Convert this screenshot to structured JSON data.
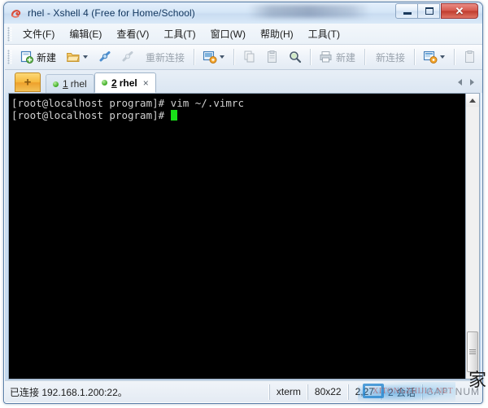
{
  "window": {
    "title": "rhel - Xshell 4 (Free for Home/School)",
    "app_icon": "xshell-icon",
    "minimize_label": "",
    "maximize_label": "",
    "close_label": "✕"
  },
  "menubar": {
    "items": [
      {
        "label": "文件(F)",
        "name": "menu-file"
      },
      {
        "label": "编辑(E)",
        "name": "menu-edit"
      },
      {
        "label": "查看(V)",
        "name": "menu-view"
      },
      {
        "label": "工具(T)",
        "name": "menu-tools"
      },
      {
        "label": "窗口(W)",
        "name": "menu-window"
      },
      {
        "label": "帮助(H)",
        "name": "menu-help"
      },
      {
        "label": "工具(T)",
        "name": "menu-tools-2"
      }
    ]
  },
  "toolbar": {
    "new_label": "新建",
    "open_label": "",
    "connect_label": "",
    "disconnect_label": "",
    "reconnect_label": "重新连接",
    "transfer_label": "",
    "copy_label": "",
    "paste_label": "",
    "find_label": "",
    "print_label": "新建",
    "newconn_label": "新连接",
    "sendkey_label": "",
    "clipboard_label": "",
    "highlight_label": "",
    "overflow_label": "»"
  },
  "tabs": {
    "new_tab_label": "+",
    "items": [
      {
        "number": "1",
        "title": "rhel",
        "active": false,
        "status": "connected"
      },
      {
        "number": "2",
        "title": "rhel",
        "active": true,
        "status": "connected"
      }
    ],
    "close_label": "×",
    "scroll_left_label": "",
    "scroll_right_label": ""
  },
  "terminal": {
    "lines": [
      "[root@localhost program]# vim ~/.vimrc",
      "[root@localhost program]# "
    ],
    "cursor_visible": true,
    "bg_color": "#000000",
    "fg_color": "#d0d0d0",
    "cursor_color": "#19e019"
  },
  "statusbar": {
    "connection": "已连接 192.168.1.200:22。",
    "terminal_type": "xterm",
    "size": "80x22",
    "cursor_pos": "2,27",
    "sessions": "2 会话",
    "caps": "CAP",
    "num": "NUM"
  },
  "watermark": {
    "text": "XITONGZHIJIA.NET",
    "cn": "家"
  }
}
